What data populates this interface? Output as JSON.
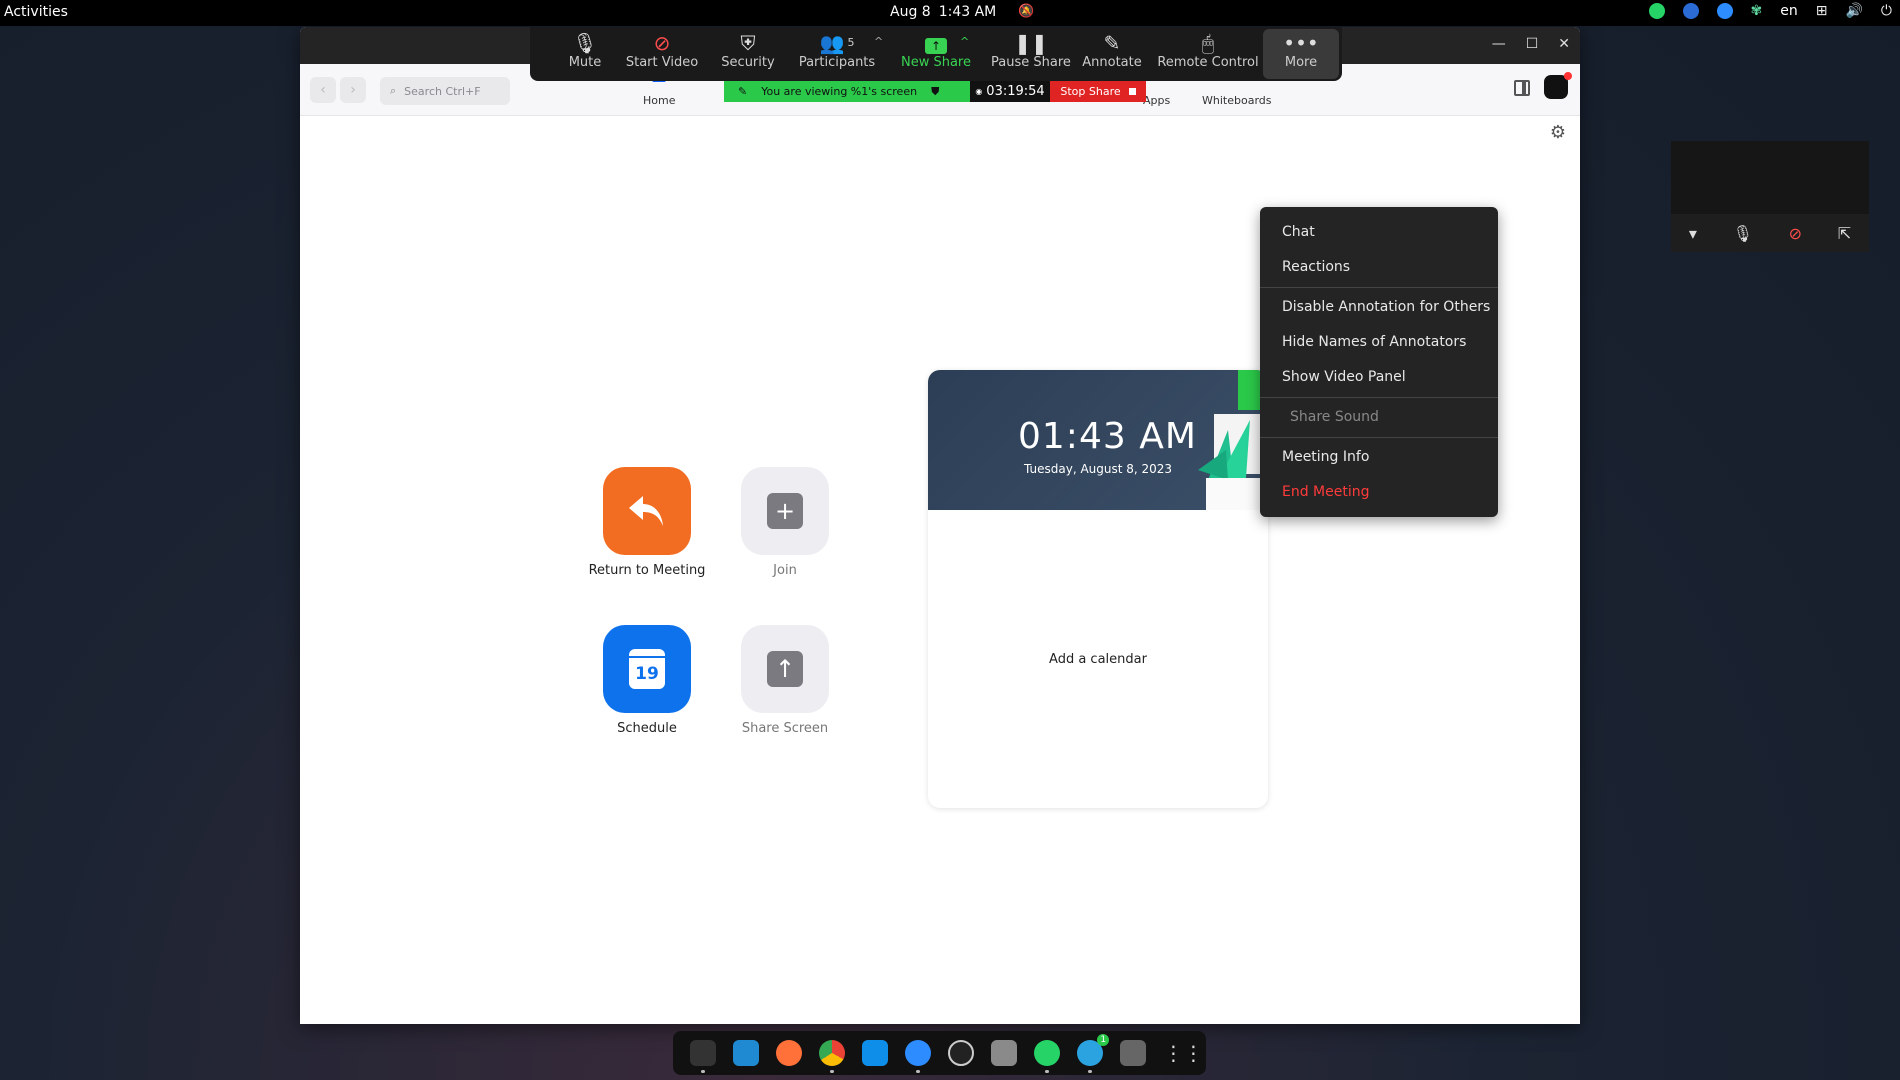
{
  "system": {
    "activities": "Activities",
    "date": "Aug 8",
    "time": "1:43 AM",
    "language": "en"
  },
  "toolbar": {
    "mute": "Mute",
    "start_video": "Start Video",
    "security": "Security",
    "participants": "Participants",
    "participants_count": "5",
    "new_share": "New Share",
    "pause_share": "Pause Share",
    "annotate": "Annotate",
    "remote_control": "Remote Control",
    "more": "More"
  },
  "share_banner": {
    "viewing": "You are viewing %1's screen",
    "timer": "03:19:54",
    "stop": "Stop Share"
  },
  "app": {
    "search_placeholder": "Search Ctrl+F",
    "tabs": {
      "home": "Home",
      "apps": "Apps",
      "whiteboards": "Whiteboards"
    }
  },
  "home": {
    "return": "Return to Meeting",
    "join": "Join",
    "schedule": "Schedule",
    "schedule_day": "19",
    "share_screen": "Share Screen"
  },
  "calendar": {
    "time": "01:43 AM",
    "date": "Tuesday, August 8, 2023",
    "add": "Add a calendar"
  },
  "more_menu": {
    "chat": "Chat",
    "reactions": "Reactions",
    "disable_annotation": "Disable Annotation for Others",
    "hide_names": "Hide Names of Annotators",
    "show_video_panel": "Show Video Panel",
    "share_sound": "Share Sound",
    "meeting_info": "Meeting Info",
    "end_meeting": "End Meeting"
  },
  "dock": {
    "telegram_badge": "1"
  },
  "colors": {
    "accent_blue": "#0e72ed",
    "return_orange": "#f26d21",
    "share_green": "#2bc94a",
    "stop_red": "#e02424",
    "danger_text": "#ff3b3b"
  }
}
